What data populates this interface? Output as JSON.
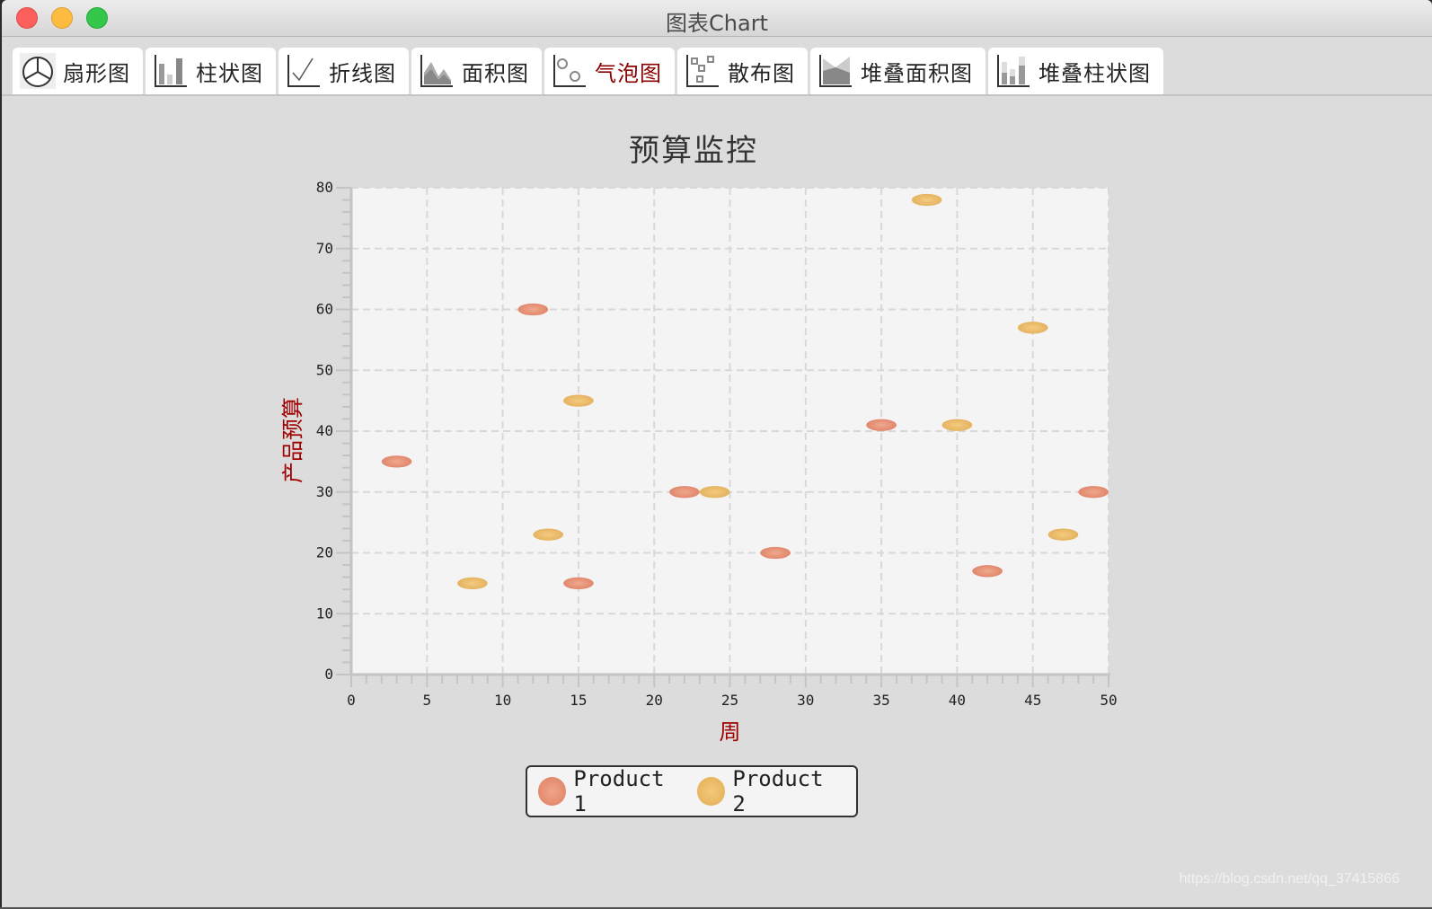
{
  "window": {
    "title": "图表Chart",
    "controls": [
      "close",
      "minimize",
      "maximize"
    ]
  },
  "tabs": [
    {
      "label": "扇形图",
      "icon": "pie-chart-icon",
      "active": false
    },
    {
      "label": "柱状图",
      "icon": "bar-chart-icon",
      "active": false
    },
    {
      "label": "折线图",
      "icon": "line-chart-icon",
      "active": false
    },
    {
      "label": "面积图",
      "icon": "area-chart-icon",
      "active": false
    },
    {
      "label": "气泡图",
      "icon": "bubble-chart-icon",
      "active": true
    },
    {
      "label": "散布图",
      "icon": "scatter-chart-icon",
      "active": false
    },
    {
      "label": "堆叠面积图",
      "icon": "stacked-area-chart-icon",
      "active": false
    },
    {
      "label": "堆叠柱状图",
      "icon": "stacked-bar-chart-icon",
      "active": false
    }
  ],
  "colors": {
    "active_tab_text": "#8b0000",
    "axis_title": "#a00000",
    "product1": "#e38a6e",
    "product2": "#e8b65e",
    "plot_bg": "#f4f4f4",
    "window_bg": "#dcdcdc"
  },
  "chart_data": {
    "type": "bubble",
    "title": "预算监控",
    "xlabel": "周",
    "ylabel": "产品预算",
    "xlim": [
      0,
      50
    ],
    "ylim": [
      0,
      80
    ],
    "x_ticks": [
      0,
      5,
      10,
      15,
      20,
      25,
      30,
      35,
      40,
      45,
      50
    ],
    "y_ticks": [
      0,
      10,
      20,
      30,
      40,
      50,
      60,
      70,
      80
    ],
    "x_minor_step": 1,
    "y_minor_step": 2,
    "grid": true,
    "legend_position": "bottom",
    "series": [
      {
        "name": "Product 1",
        "color": "#e38a6e",
        "points": [
          {
            "x": 3,
            "y": 35,
            "r": 1
          },
          {
            "x": 12,
            "y": 60,
            "r": 1
          },
          {
            "x": 15,
            "y": 15,
            "r": 1
          },
          {
            "x": 22,
            "y": 30,
            "r": 1
          },
          {
            "x": 28,
            "y": 20,
            "r": 1
          },
          {
            "x": 35,
            "y": 41,
            "r": 1
          },
          {
            "x": 42,
            "y": 17,
            "r": 1
          },
          {
            "x": 49,
            "y": 30,
            "r": 1
          }
        ]
      },
      {
        "name": "Product 2",
        "color": "#e8b65e",
        "points": [
          {
            "x": 8,
            "y": 15,
            "r": 1
          },
          {
            "x": 13,
            "y": 23,
            "r": 1
          },
          {
            "x": 15,
            "y": 45,
            "r": 1
          },
          {
            "x": 24,
            "y": 30,
            "r": 1
          },
          {
            "x": 38,
            "y": 78,
            "r": 1
          },
          {
            "x": 40,
            "y": 41,
            "r": 1
          },
          {
            "x": 45,
            "y": 57,
            "r": 1
          },
          {
            "x": 47,
            "y": 23,
            "r": 1
          }
        ]
      }
    ]
  },
  "legend": {
    "items": [
      {
        "label": "Product 1"
      },
      {
        "label": "Product 2"
      }
    ]
  },
  "watermark": "https://blog.csdn.net/qq_37415866"
}
